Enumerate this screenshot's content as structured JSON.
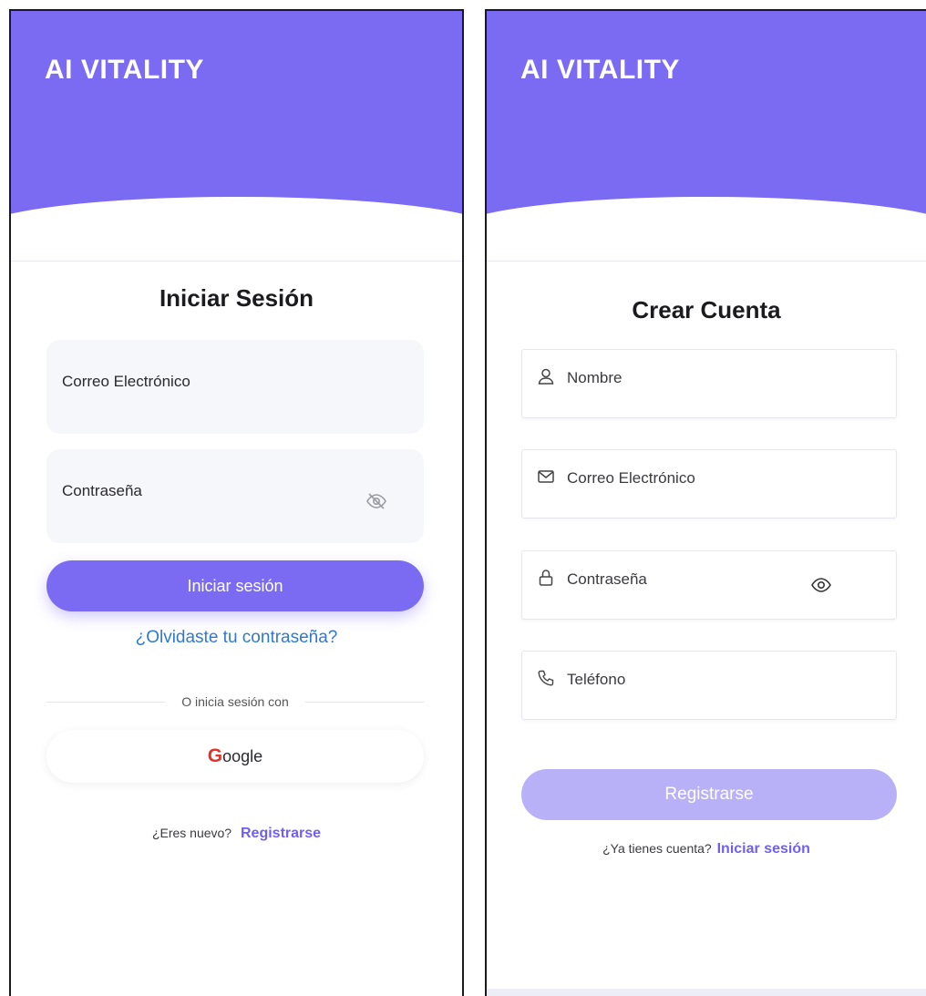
{
  "login": {
    "brand": "AI VITALITY",
    "title": "Iniciar Sesión",
    "email_label": "Correo Electrónico",
    "password_label": "Contraseña",
    "submit_label": "Iniciar sesión",
    "forgot_label": "¿Olvidaste tu contraseña?",
    "divider_label": "O inicia sesión con",
    "google_first": "G",
    "google_rest": "oogle",
    "new_prompt": "¿Eres nuevo?",
    "register_link": "Registrarse"
  },
  "register": {
    "brand": "AI VITALITY",
    "title": "Crear Cuenta",
    "name_label": "Nombre",
    "email_label": "Correo Electrónico",
    "password_label": "Contraseña",
    "phone_label": "Teléfono",
    "submit_label": "Registrarse",
    "have_account_prompt": "¿Ya tienes cuenta?",
    "login_link": "Iniciar sesión"
  },
  "colors": {
    "primary": "#7a6bf2",
    "primary_disabled": "#b9b1f7",
    "link_blue": "#2f78d6",
    "google_red": "#e0332c"
  },
  "icons": [
    "eye-off-icon",
    "user-icon",
    "mail-icon",
    "lock-icon",
    "eye-icon",
    "phone-icon"
  ]
}
